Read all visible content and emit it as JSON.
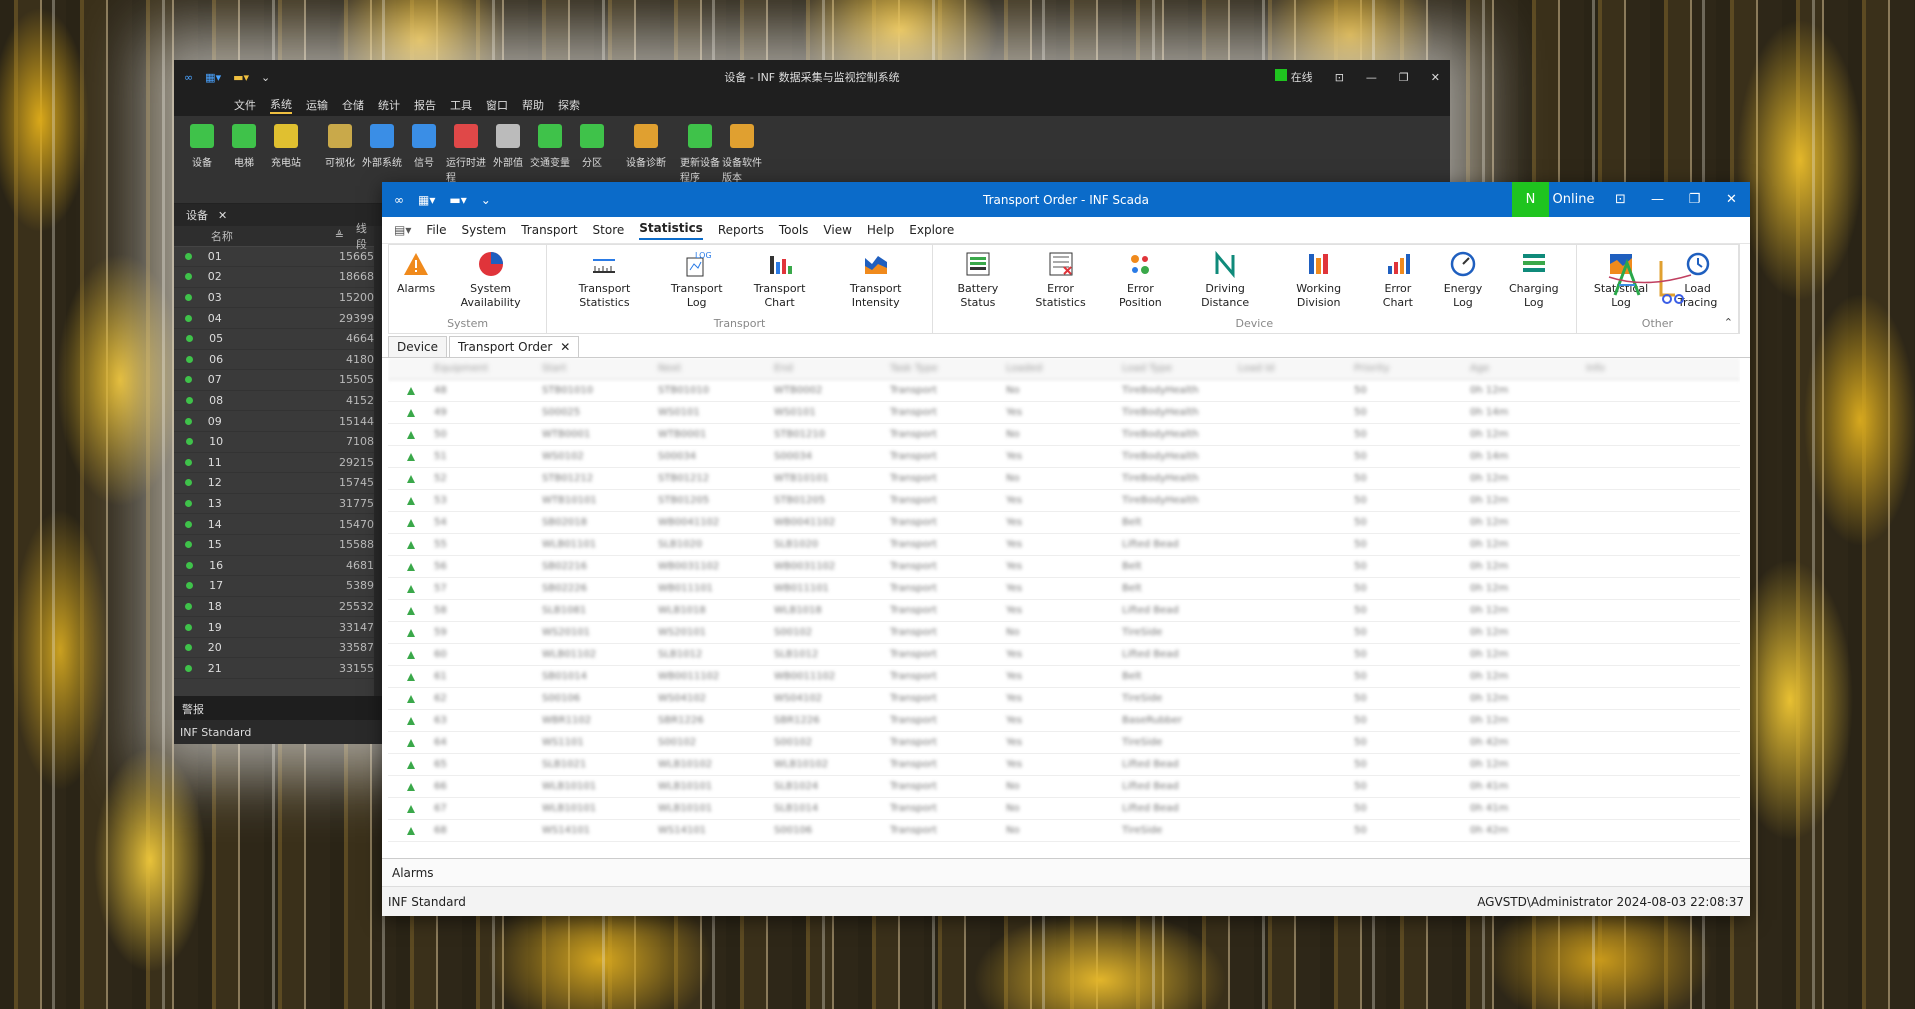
{
  "back_window": {
    "title": "设备 - INF 数据采集与监视控制系统",
    "online_label": "在线",
    "menu": [
      "文件",
      "系统",
      "运输",
      "仓储",
      "统计",
      "报告",
      "工具",
      "窗口",
      "帮助",
      "探索"
    ],
    "menu_active_index": 1,
    "ribbon": [
      {
        "label": "设备",
        "color": "#3fc24a"
      },
      {
        "label": "电梯",
        "color": "#3fc24a"
      },
      {
        "label": "充电站",
        "color": "#e0c030"
      },
      {
        "label": "可视化",
        "color": "#c9a94a"
      },
      {
        "label": "外部系统",
        "color": "#3a8ee6"
      },
      {
        "label": "信号",
        "color": "#3a8ee6"
      },
      {
        "label": "运行时进程",
        "color": "#e04848"
      },
      {
        "label": "外部值",
        "color": "#bbbbbb"
      },
      {
        "label": "交通变量",
        "color": "#3fc24a"
      },
      {
        "label": "分区",
        "color": "#3fc24a"
      },
      {
        "label": "设备诊断",
        "color": "#e0a030"
      },
      {
        "label": "更新设备程序",
        "color": "#3fc24a"
      },
      {
        "label": "设备软件版本",
        "color": "#e0a030"
      }
    ],
    "group_label": "设备",
    "tab_label": "设备",
    "grid_headers": {
      "name": "名称",
      "line": "线段"
    },
    "rows": [
      {
        "name": "01",
        "line": "15665"
      },
      {
        "name": "02",
        "line": "18668"
      },
      {
        "name": "03",
        "line": "15200"
      },
      {
        "name": "04",
        "line": "29399"
      },
      {
        "name": "05",
        "line": "4664"
      },
      {
        "name": "06",
        "line": "4180"
      },
      {
        "name": "07",
        "line": "15505"
      },
      {
        "name": "08",
        "line": "4152"
      },
      {
        "name": "09",
        "line": "15144"
      },
      {
        "name": "10",
        "line": "7108"
      },
      {
        "name": "11",
        "line": "29215"
      },
      {
        "name": "12",
        "line": "15745"
      },
      {
        "name": "13",
        "line": "31775"
      },
      {
        "name": "14",
        "line": "15470"
      },
      {
        "name": "15",
        "line": "15588"
      },
      {
        "name": "16",
        "line": "4681"
      },
      {
        "name": "17",
        "line": "5389"
      },
      {
        "name": "18",
        "line": "25532"
      },
      {
        "name": "19",
        "line": "33147"
      },
      {
        "name": "20",
        "line": "33587"
      },
      {
        "name": "21",
        "line": "33155"
      }
    ],
    "alarms_label": "警报",
    "status_left": "INF Standard"
  },
  "front_window": {
    "title": "Transport Order - INF Scada",
    "online_label": "Online",
    "online_badge": "N",
    "menu": [
      "File",
      "System",
      "Transport",
      "Store",
      "Statistics",
      "Reports",
      "Tools",
      "View",
      "Help",
      "Explore"
    ],
    "menu_active_index": 4,
    "ribbon_groups": [
      {
        "label": "System",
        "buttons": [
          {
            "label": "Alarms",
            "icon": "warning-icon"
          },
          {
            "label": "System Availability",
            "icon": "pie-chart-icon"
          }
        ]
      },
      {
        "label": "Transport",
        "buttons": [
          {
            "label": "Transport Statistics",
            "icon": "ruler-chart-icon"
          },
          {
            "label": "Transport Log",
            "icon": "log-icon"
          },
          {
            "label": "Transport Chart",
            "icon": "bar-chart-icon"
          },
          {
            "label": "Transport Intensity",
            "icon": "intensity-icon"
          }
        ]
      },
      {
        "label": "Device",
        "buttons": [
          {
            "label": "Battery Status",
            "icon": "battery-icon"
          },
          {
            "label": "Error Statistics",
            "icon": "error-list-icon"
          },
          {
            "label": "Error Position",
            "icon": "error-position-icon"
          },
          {
            "label": "Driving Distance",
            "icon": "driving-distance-icon"
          },
          {
            "label": "Working Division",
            "icon": "working-division-icon"
          },
          {
            "label": "Error Chart",
            "icon": "error-chart-icon"
          },
          {
            "label": "Energy Log",
            "icon": "gauge-icon"
          },
          {
            "label": "Charging Log",
            "icon": "charging-log-icon"
          }
        ]
      },
      {
        "label": "Other",
        "buttons": [
          {
            "label": "Statistical Log",
            "icon": "statistical-log-icon"
          },
          {
            "label": "Load Tracing",
            "icon": "history-icon"
          }
        ]
      }
    ],
    "doc_tabs": [
      {
        "label": "Device"
      },
      {
        "label": "Transport Order",
        "close": "✕"
      }
    ],
    "table_headers": [
      "Equipment",
      "Start",
      "Next",
      "End",
      "Task Type",
      "Loaded",
      "Load Type",
      "Load Id",
      "Priority",
      "Age",
      "Info"
    ],
    "table_rows": [
      [
        "48",
        "STB01010",
        "STB01010",
        "WTB0002",
        "Transport",
        "No",
        "TireBodyHealth",
        "",
        "50",
        "0h 12m",
        ""
      ],
      [
        "49",
        "S00025",
        "WS0101",
        "WS0101",
        "Transport",
        "Yes",
        "TireBodyHealth",
        "",
        "50",
        "0h 14m",
        ""
      ],
      [
        "50",
        "WTB0001",
        "WTB0001",
        "STB01210",
        "Transport",
        "No",
        "TireBodyHealth",
        "",
        "50",
        "0h 12m",
        ""
      ],
      [
        "51",
        "WS0102",
        "S00034",
        "S00034",
        "Transport",
        "Yes",
        "TireBodyHealth",
        "",
        "50",
        "0h 14m",
        ""
      ],
      [
        "52",
        "STB01212",
        "STB01212",
        "WTB10101",
        "Transport",
        "No",
        "TireBodyHealth",
        "",
        "50",
        "0h 12m",
        ""
      ],
      [
        "53",
        "WTB10101",
        "STB01205",
        "STB01205",
        "Transport",
        "Yes",
        "TireBodyHealth",
        "",
        "50",
        "0h 12m",
        ""
      ],
      [
        "54",
        "SB02018",
        "WB0041102",
        "WB0041102",
        "Transport",
        "Yes",
        "Belt",
        "",
        "50",
        "0h 12m",
        ""
      ],
      [
        "55",
        "WLB01101",
        "SLB1020",
        "SLB1020",
        "Transport",
        "Yes",
        "Lifted Bead",
        "",
        "50",
        "0h 12m",
        ""
      ],
      [
        "56",
        "SB02216",
        "WB0031102",
        "WB0031102",
        "Transport",
        "Yes",
        "Belt",
        "",
        "50",
        "0h 12m",
        ""
      ],
      [
        "57",
        "SB02226",
        "WB011101",
        "WB011101",
        "Transport",
        "Yes",
        "Belt",
        "",
        "50",
        "0h 12m",
        ""
      ],
      [
        "58",
        "SLB1081",
        "WLB1018",
        "WLB1018",
        "Transport",
        "Yes",
        "Lifted Bead",
        "",
        "50",
        "0h 12m",
        ""
      ],
      [
        "59",
        "WS20101",
        "WS20101",
        "S00102",
        "Transport",
        "No",
        "TireSide",
        "",
        "50",
        "0h 12m",
        ""
      ],
      [
        "60",
        "WLB01102",
        "SLB1012",
        "SLB1012",
        "Transport",
        "Yes",
        "Lifted Bead",
        "",
        "50",
        "0h 12m",
        ""
      ],
      [
        "61",
        "SB01014",
        "WB0011102",
        "WB0011102",
        "Transport",
        "Yes",
        "Belt",
        "",
        "50",
        "0h 12m",
        ""
      ],
      [
        "62",
        "S00106",
        "WS04102",
        "WS04102",
        "Transport",
        "Yes",
        "TireSide",
        "",
        "50",
        "0h 12m",
        ""
      ],
      [
        "63",
        "WBR1102",
        "SBR1226",
        "SBR1226",
        "Transport",
        "Yes",
        "BaseRubber",
        "",
        "50",
        "0h 12m",
        ""
      ],
      [
        "64",
        "WS1101",
        "S00102",
        "S00102",
        "Transport",
        "Yes",
        "TireSide",
        "",
        "50",
        "0h 42m",
        ""
      ],
      [
        "65",
        "SLB1021",
        "WLB10102",
        "WLB10102",
        "Transport",
        "Yes",
        "Lifted Bead",
        "",
        "50",
        "0h 12m",
        ""
      ],
      [
        "66",
        "WLB10101",
        "WLB10101",
        "SLB1024",
        "Transport",
        "No",
        "Lifted Bead",
        "",
        "50",
        "0h 41m",
        ""
      ],
      [
        "67",
        "WLB10101",
        "WLB10101",
        "SLB1014",
        "Transport",
        "No",
        "Lifted Bead",
        "",
        "50",
        "0h 41m",
        ""
      ],
      [
        "68",
        "WS14101",
        "WS14101",
        "S00106",
        "Transport",
        "No",
        "TireSide",
        "",
        "50",
        "0h 42m",
        ""
      ]
    ],
    "alarms_label": "Alarms",
    "status_left": "INF Standard",
    "status_right": "AGVSTD\\Administrator   2024-08-03 22:08:37"
  }
}
